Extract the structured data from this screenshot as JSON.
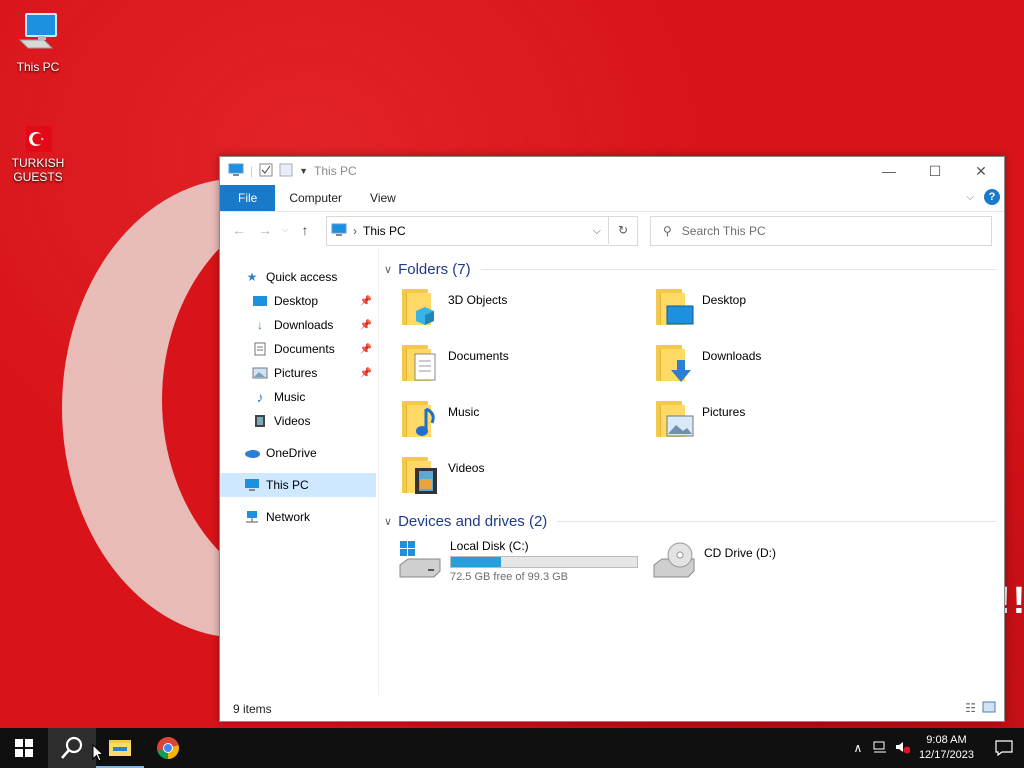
{
  "desktop": {
    "icons": [
      {
        "label": "This PC"
      },
      {
        "label": "TURKISH GUESTS"
      }
    ],
    "background_colors": {
      "red": "#d8141a",
      "crescent": "#e9d3cd"
    }
  },
  "window": {
    "title": "This PC",
    "controls": {
      "minimize": "—",
      "maximize": "☐",
      "close": "✕"
    },
    "ribbon_tabs": [
      {
        "label": "File",
        "active": true
      },
      {
        "label": "Computer"
      },
      {
        "label": "View"
      }
    ],
    "help_label": "?",
    "address": {
      "crumb": "This PC"
    },
    "search": {
      "placeholder": "Search This PC"
    },
    "nav": {
      "quick_access": "Quick access",
      "items": [
        {
          "label": "Desktop",
          "pinned": true
        },
        {
          "label": "Downloads",
          "pinned": true
        },
        {
          "label": "Documents",
          "pinned": true
        },
        {
          "label": "Pictures",
          "pinned": true
        },
        {
          "label": "Music"
        },
        {
          "label": "Videos"
        }
      ],
      "onedrive": "OneDrive",
      "this_pc": "This PC",
      "network": "Network"
    },
    "folders_header": "Folders (7)",
    "folders": [
      {
        "label": "3D Objects"
      },
      {
        "label": "Desktop"
      },
      {
        "label": "Documents"
      },
      {
        "label": "Downloads"
      },
      {
        "label": "Music"
      },
      {
        "label": "Pictures"
      },
      {
        "label": "Videos"
      }
    ],
    "devices_header": "Devices and drives (2)",
    "drives": [
      {
        "label": "Local Disk (C:)",
        "free_text": "72.5 GB free of 99.3 GB",
        "used_fraction": 0.27
      },
      {
        "label": "CD Drive (D:)"
      }
    ],
    "status": {
      "count": "9 items"
    }
  },
  "taskbar": {
    "clock_time": "9:08 AM",
    "clock_date": "12/17/2023",
    "accent": "#26a0da"
  }
}
